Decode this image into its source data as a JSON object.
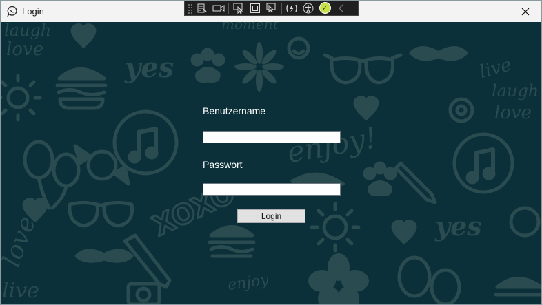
{
  "window": {
    "title": "Login",
    "close_glyph": "✕"
  },
  "debug_toolbar": {
    "icons": [
      "live-visual-tree-icon",
      "video-icon",
      "select-element-icon",
      "display-layout-adorners-icon",
      "track-focus-icon",
      "hot-reload-icon",
      "accessibility-icon",
      "binding-ok-icon",
      "collapse-chevron-icon"
    ],
    "ok_glyph": "✓",
    "chevron_glyph": "‹"
  },
  "form": {
    "username_label": "Benutzername",
    "username_value": "",
    "password_label": "Passwort",
    "password_value": "",
    "login_button": "Login"
  },
  "colors": {
    "background": "#0b3039",
    "pattern": "#2a4b4f",
    "text": "#ffffff"
  }
}
